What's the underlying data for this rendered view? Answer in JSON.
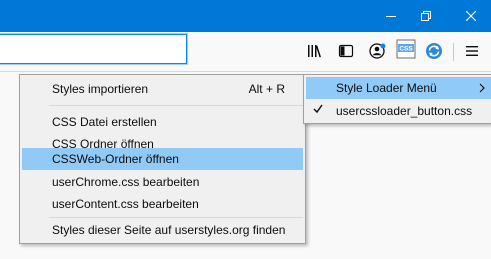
{
  "window": {
    "buttons": [
      {
        "name": "minimize-button",
        "icon": "minimize-icon"
      },
      {
        "name": "restore-button",
        "icon": "restore-icon"
      },
      {
        "name": "close-button",
        "icon": "close-icon"
      }
    ]
  },
  "toolbar": {
    "icons": [
      "library-icon",
      "sidebar-icon",
      "account-icon",
      "css-icon",
      "sync-icon",
      "hamburger-menu-icon"
    ],
    "css_icon_text": "CSS"
  },
  "menu": {
    "items": [
      {
        "label": "Styles importieren",
        "accel": "Alt + R"
      },
      {
        "label": "CSS Datei erstellen"
      },
      {
        "label": "CSS Ordner öffnen"
      },
      {
        "label": "CSSWeb-Ordner öffnen"
      },
      {
        "label": "userChrome.css bearbeiten"
      },
      {
        "label": "userContent.css bearbeiten"
      },
      {
        "label": "Styles dieser Seite auf userstyles.org finden"
      }
    ],
    "highlighted_index": 3
  },
  "submenu": {
    "items": [
      {
        "label": "Style Loader Menü"
      },
      {
        "label": "usercssloader_button.css",
        "checked": true
      }
    ]
  },
  "colors": {
    "titlebar": "#0078d7",
    "highlight": "#91c9f7",
    "menu_bg": "#f0f0f0"
  }
}
